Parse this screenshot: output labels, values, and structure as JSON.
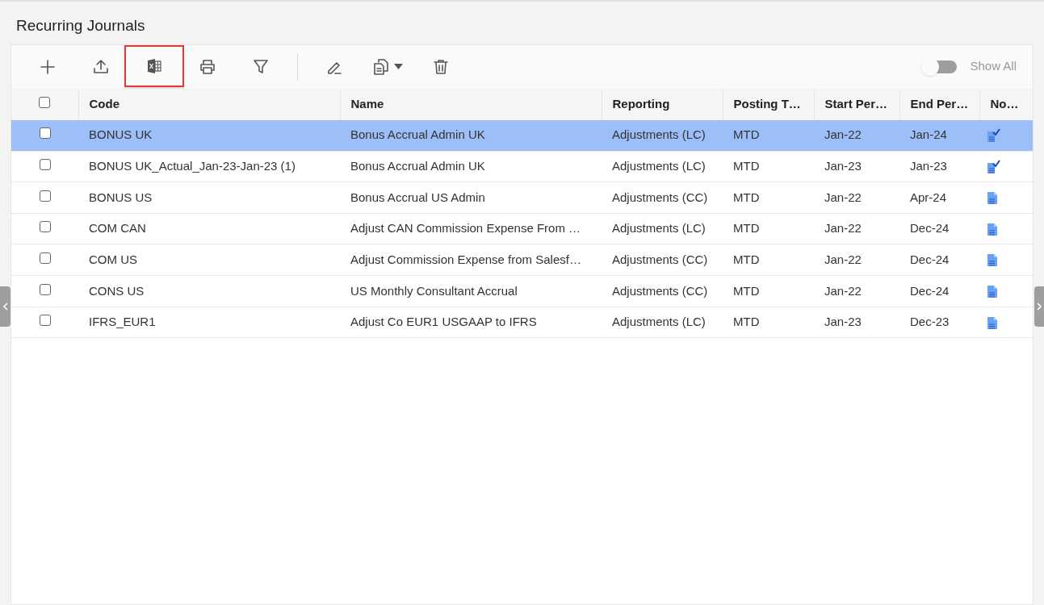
{
  "page_title": "Recurring Journals",
  "toolbar_groups": [
    [
      {
        "kind": "add",
        "highlighted": false
      },
      {
        "kind": "upload",
        "highlighted": false
      },
      {
        "kind": "excel",
        "highlighted": true
      },
      {
        "kind": "print",
        "highlighted": false
      },
      {
        "kind": "filter",
        "highlighted": false
      }
    ],
    [
      {
        "kind": "edit",
        "highlighted": false
      },
      {
        "kind": "copy",
        "highlighted": false
      },
      {
        "kind": "delete",
        "highlighted": false
      }
    ]
  ],
  "show_all": {
    "label": "Show All",
    "on": false
  },
  "table": {
    "header_checked": false,
    "columns": [
      "Code",
      "Name",
      "Reporting",
      "Posting T…",
      "Start Per…",
      "End Per…",
      "No…"
    ],
    "rows": [
      {
        "selected": true,
        "checked": false,
        "cells": [
          "BONUS UK",
          "Bonus Accrual Admin UK",
          "Adjustments (LC)",
          "MTD",
          "Jan-22",
          "Jan-24"
        ],
        "note_checked": true
      },
      {
        "selected": false,
        "checked": false,
        "cells": [
          "BONUS UK_Actual_Jan-23-Jan-23 (1)",
          "Bonus Accrual Admin UK",
          "Adjustments (LC)",
          "MTD",
          "Jan-23",
          "Jan-23"
        ],
        "note_checked": true
      },
      {
        "selected": false,
        "checked": false,
        "cells": [
          "BONUS US",
          "Bonus Accrual US Admin",
          "Adjustments (CC)",
          "MTD",
          "Jan-22",
          "Apr-24"
        ],
        "note_checked": false
      },
      {
        "selected": false,
        "checked": false,
        "cells": [
          "COM CAN",
          "Adjust CAN Commission Expense From …",
          "Adjustments (LC)",
          "MTD",
          "Jan-22",
          "Dec-24"
        ],
        "note_checked": false
      },
      {
        "selected": false,
        "checked": false,
        "cells": [
          "COM US",
          "Adjust Commission Expense from Salesf…",
          "Adjustments (CC)",
          "MTD",
          "Jan-22",
          "Dec-24"
        ],
        "note_checked": false
      },
      {
        "selected": false,
        "checked": false,
        "cells": [
          "CONS US",
          "US Monthly Consultant Accrual",
          "Adjustments (CC)",
          "MTD",
          "Jan-22",
          "Dec-24"
        ],
        "note_checked": false
      },
      {
        "selected": false,
        "checked": false,
        "cells": [
          "IFRS_EUR1",
          "Adjust Co EUR1 USGAAP to IFRS",
          "Adjustments (LC)",
          "MTD",
          "Jan-23",
          "Dec-23"
        ],
        "note_checked": false
      }
    ]
  }
}
